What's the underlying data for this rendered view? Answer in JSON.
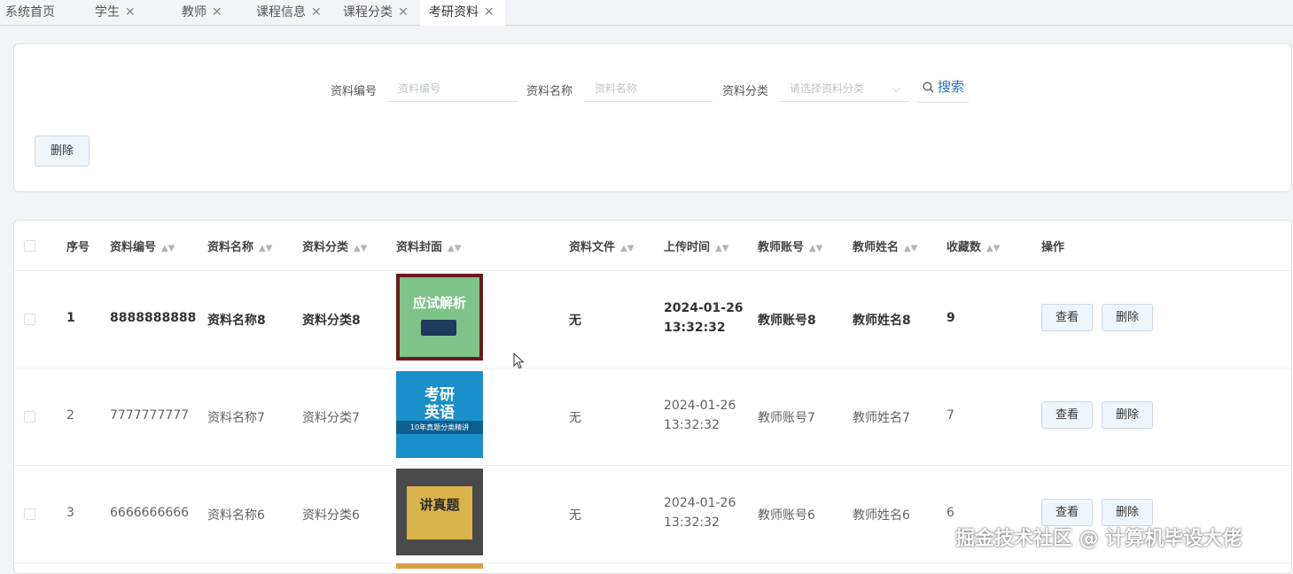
{
  "tabs": [
    {
      "label": "系统首页",
      "closable": false,
      "active": false
    },
    {
      "label": "学生",
      "closable": true,
      "active": false
    },
    {
      "label": "教师",
      "closable": true,
      "active": false
    },
    {
      "label": "课程信息",
      "closable": true,
      "active": false
    },
    {
      "label": "课程分类",
      "closable": true,
      "active": false
    },
    {
      "label": "考研资料",
      "closable": true,
      "active": true
    }
  ],
  "close_glyph": "✕",
  "search": {
    "code_label": "资料编号",
    "code_placeholder": "资料编号",
    "name_label": "资料名称",
    "name_placeholder": "资料名称",
    "category_label": "资料分类",
    "category_placeholder": "请选择资料分类",
    "search_button": "搜索",
    "delete_button": "删除"
  },
  "table": {
    "columns": {
      "index": "序号",
      "code": "资料编号",
      "name": "资料名称",
      "category": "资料分类",
      "cover": "资料封面",
      "file": "资料文件",
      "upload_time": "上传时间",
      "teacher_account": "教师账号",
      "teacher_name": "教师姓名",
      "favorites": "收藏数",
      "actions": "操作"
    },
    "sort_glyph": "▲▼",
    "view_button": "查看",
    "delete_button": "删除",
    "rows": [
      {
        "index": "1",
        "code": "8888888888",
        "name": "资料名称8",
        "category": "资料分类8",
        "file": "无",
        "date": "2024-01-26",
        "time": "13:32:32",
        "teacher_account": "教师账号8",
        "teacher_name": "教师姓名8",
        "favorites": "9",
        "cover_title": "应试解析"
      },
      {
        "index": "2",
        "code": "7777777777",
        "name": "资料名称7",
        "category": "资料分类7",
        "file": "无",
        "date": "2024-01-26",
        "time": "13:32:32",
        "teacher_account": "教师账号7",
        "teacher_name": "教师姓名7",
        "favorites": "7",
        "cover_title_1": "考研",
        "cover_title_2": "英语",
        "cover_subtitle": "10年真题分类精讲"
      },
      {
        "index": "3",
        "code": "6666666666",
        "name": "资料名称6",
        "category": "资料分类6",
        "file": "无",
        "date": "2024-01-26",
        "time": "13:32:32",
        "teacher_account": "教师账号6",
        "teacher_name": "教师姓名6",
        "favorites": "6",
        "cover_title": "讲真题"
      }
    ]
  },
  "watermark": "掘金技术社区 @ 计算机毕设大佬",
  "colors": {
    "accent": "#2f6fb7",
    "button_bg": "#eef5fb",
    "page_bg": "#f3f4f7"
  }
}
